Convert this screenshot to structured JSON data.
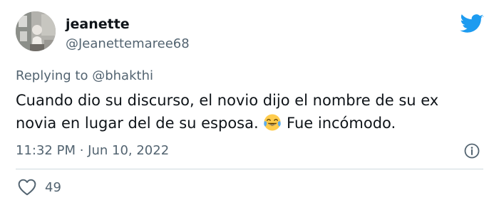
{
  "user": {
    "display_name": "jeanette",
    "handle": "@Jeanettemaree68",
    "avatar_icon": "avatar-photo"
  },
  "brand": {
    "icon": "twitter-bird-icon",
    "color": "#1d9bf0"
  },
  "reply": {
    "prefix": "Replying to",
    "to": "@bhakthi"
  },
  "tweet": {
    "text_part1": "Cuando dio su discurso, el novio dijo el nombre de su ex novia en lugar del de su esposa.",
    "emoji_icon": "face-with-tears-of-joy-emoji",
    "text_part2": "Fue incómodo.",
    "timestamp": "11:32 PM · Jun 10, 2022"
  },
  "actions": {
    "like_icon": "heart-icon",
    "like_count": "49",
    "info_icon": "info-icon"
  },
  "colors": {
    "text": "#0f1419",
    "secondary": "#536471",
    "divider": "#cfd9de"
  }
}
